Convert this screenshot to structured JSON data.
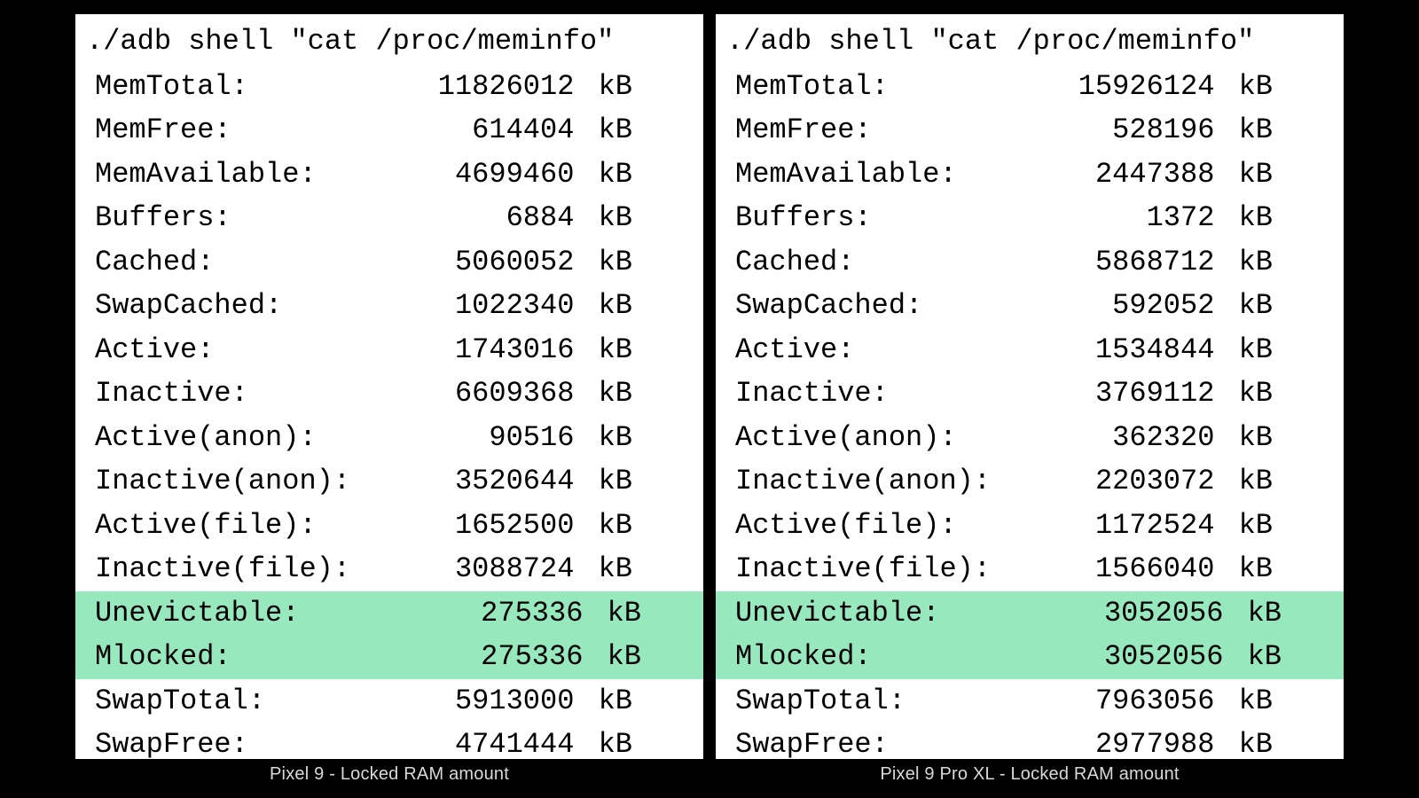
{
  "left": {
    "command": "./adb shell \"cat /proc/meminfo\"",
    "caption": "Pixel 9 - Locked RAM amount",
    "rows": [
      {
        "label": "MemTotal:",
        "value": "11826012",
        "unit": "kB",
        "hl": false
      },
      {
        "label": "MemFree:",
        "value": "614404",
        "unit": "kB",
        "hl": false
      },
      {
        "label": "MemAvailable:",
        "value": "4699460",
        "unit": "kB",
        "hl": false
      },
      {
        "label": "Buffers:",
        "value": "6884",
        "unit": "kB",
        "hl": false
      },
      {
        "label": "Cached:",
        "value": "5060052",
        "unit": "kB",
        "hl": false
      },
      {
        "label": "SwapCached:",
        "value": "1022340",
        "unit": "kB",
        "hl": false
      },
      {
        "label": "Active:",
        "value": "1743016",
        "unit": "kB",
        "hl": false
      },
      {
        "label": "Inactive:",
        "value": "6609368",
        "unit": "kB",
        "hl": false
      },
      {
        "label": "Active(anon):",
        "value": "90516",
        "unit": "kB",
        "hl": false
      },
      {
        "label": "Inactive(anon):",
        "value": "3520644",
        "unit": "kB",
        "hl": false
      },
      {
        "label": "Active(file):",
        "value": "1652500",
        "unit": "kB",
        "hl": false
      },
      {
        "label": "Inactive(file):",
        "value": "3088724",
        "unit": "kB",
        "hl": false
      },
      {
        "label": "Unevictable:",
        "value": "275336",
        "unit": "kB",
        "hl": true
      },
      {
        "label": "Mlocked:",
        "value": "275336",
        "unit": "kB",
        "hl": true
      },
      {
        "label": "SwapTotal:",
        "value": "5913000",
        "unit": "kB",
        "hl": false
      },
      {
        "label": "SwapFree:",
        "value": "4741444",
        "unit": "kB",
        "hl": false
      }
    ]
  },
  "right": {
    "command": "./adb shell \"cat /proc/meminfo\"",
    "caption": "Pixel 9 Pro XL - Locked RAM amount",
    "rows": [
      {
        "label": "MemTotal:",
        "value": "15926124",
        "unit": "kB",
        "hl": false
      },
      {
        "label": "MemFree:",
        "value": "528196",
        "unit": "kB",
        "hl": false
      },
      {
        "label": "MemAvailable:",
        "value": "2447388",
        "unit": "kB",
        "hl": false
      },
      {
        "label": "Buffers:",
        "value": "1372",
        "unit": "kB",
        "hl": false
      },
      {
        "label": "Cached:",
        "value": "5868712",
        "unit": "kB",
        "hl": false
      },
      {
        "label": "SwapCached:",
        "value": "592052",
        "unit": "kB",
        "hl": false
      },
      {
        "label": "Active:",
        "value": "1534844",
        "unit": "kB",
        "hl": false
      },
      {
        "label": "Inactive:",
        "value": "3769112",
        "unit": "kB",
        "hl": false
      },
      {
        "label": "Active(anon):",
        "value": "362320",
        "unit": "kB",
        "hl": false
      },
      {
        "label": "Inactive(anon):",
        "value": "2203072",
        "unit": "kB",
        "hl": false
      },
      {
        "label": "Active(file):",
        "value": "1172524",
        "unit": "kB",
        "hl": false
      },
      {
        "label": "Inactive(file):",
        "value": "1566040",
        "unit": "kB",
        "hl": false
      },
      {
        "label": "Unevictable:",
        "value": "3052056",
        "unit": "kB",
        "hl": true
      },
      {
        "label": "Mlocked:",
        "value": "3052056",
        "unit": "kB",
        "hl": true
      },
      {
        "label": "SwapTotal:",
        "value": "7963056",
        "unit": "kB",
        "hl": false
      },
      {
        "label": "SwapFree:",
        "value": "2977988",
        "unit": "kB",
        "hl": false
      }
    ]
  }
}
